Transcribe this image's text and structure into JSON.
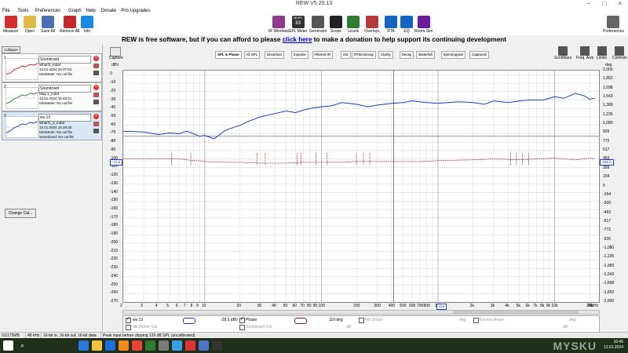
{
  "window": {
    "title": "REW V5.20.13"
  },
  "menu": [
    "File",
    "Tools",
    "Preferences",
    "Graph",
    "Help",
    "Donate",
    "Pro Upgrades"
  ],
  "toolbar_left": [
    {
      "label": "Measure",
      "color": "#d32f2f"
    },
    {
      "label": "Open",
      "color": "#e2b84a"
    },
    {
      "label": "Save All",
      "color": "#4a6fb5"
    },
    {
      "label": "Remove All",
      "color": "#c62828"
    },
    {
      "label": "Info",
      "color": "#1e88e5"
    }
  ],
  "toolbar_right": [
    {
      "label": "IR Windows",
      "color": "#8e3a8e"
    },
    {
      "label": "SPL Meter",
      "color": "#333333",
      "value": "83",
      "unit": "dB SPL"
    },
    {
      "label": "Generator",
      "color": "#555555"
    },
    {
      "label": "Scope",
      "color": "#222222"
    },
    {
      "label": "Levels",
      "color": "#2e7d32"
    },
    {
      "label": "Overlays",
      "color": "#b23b3b"
    },
    {
      "label": "RTA",
      "color": "#1565c0"
    },
    {
      "label": "EQ",
      "color": "#1565c0"
    },
    {
      "label": "Room Sim",
      "color": "#6a1b9a"
    }
  ],
  "preferences_label": "Preferences",
  "banner": {
    "text": "REW is free software, but if you can afford to please ",
    "link": "click here",
    "tail": " to make a donation to help support its continuing development"
  },
  "left": {
    "collapse": "Collapse",
    "change_cal": "Change Cal...",
    "measurements": [
      {
        "num": "1",
        "name": "Soundcard",
        "file": "Wharf1_mdat",
        "date": "13.01.2024 16:37:54",
        "cal1": "Mic/Meter: No cal file",
        "cal2": "",
        "thumb_color": "#c62828",
        "sel": false
      },
      {
        "num": "2",
        "name": "Soundcard",
        "file": "Mag 1_mdat",
        "date": "13.01.2024 16:45:21",
        "cal1": "Mic/Meter: No cal file",
        "cal2": "",
        "thumb_color": "#2e7d32",
        "sel": false
      },
      {
        "num": "3",
        "name": "ws 13",
        "file": "Wharf1_2_mdat",
        "date": "13.01.2024 16:48:26",
        "cal1": "Mic/Meter: No cal file",
        "cal2": "Soundcard: No cal file",
        "thumb_color": "#1e3bc9",
        "sel": true
      }
    ]
  },
  "graph": {
    "capture_label": "Capture",
    "tabs": [
      "SPL & Phase",
      "All SPL",
      "Distortion",
      "Impulse",
      "Filtered IR",
      "GD",
      "RT60 Decay",
      "Clarity",
      "Decay",
      "Waterfall",
      "Spectrogram",
      "Captured"
    ],
    "side_buttons": [
      "Scrollbars",
      "Freq. Axis",
      "Limits",
      "Controls"
    ],
    "y_unit_left": "dBV",
    "y_unit_right": "deg",
    "y_left": [
      "0",
      "-10",
      "-20",
      "-30",
      "-40",
      "-50",
      "-60",
      "-70",
      "-80",
      "-90",
      "-100",
      "-110",
      "-120",
      "-130",
      "-140",
      "-150",
      "-160",
      "-170",
      "-180",
      "-190",
      "-200",
      "-210",
      "-220",
      "-230",
      "-240",
      "-250",
      "-260",
      "-270"
    ],
    "y_right": [
      "2,000",
      "1,852",
      "1,698",
      "1,543",
      "1,389",
      "1,235",
      "1,080",
      "926",
      "772",
      "617",
      "463",
      "309",
      "154",
      "0",
      "-154",
      "-309",
      "-463",
      "-617",
      "-772",
      "-926",
      "-1,080",
      "-1,235",
      "-1,389",
      "-1,543",
      "-1,698",
      "-1,852",
      "-2,000"
    ],
    "cursor_left": "-72.6",
    "cursor_right": "169.0",
    "cursor_freq": "416",
    "x_ticks": [
      "2",
      "3",
      "4",
      "5",
      "6",
      "7",
      "8",
      "9",
      "10",
      "20",
      "30",
      "40",
      "50",
      "60",
      "70",
      "80",
      "90",
      "100",
      "200",
      "300",
      "400",
      "500",
      "600",
      "700",
      "800",
      "1k",
      "2k",
      "3k",
      "4k",
      "5k",
      "6k",
      "7k",
      "8k",
      "9k",
      "10k",
      "20k",
      "24kHz"
    ]
  },
  "chart_data": {
    "type": "line",
    "xscale": "log",
    "xlim": [
      2,
      24000
    ],
    "ylim_left": [
      -270,
      5
    ],
    "ylabel": "dBV",
    "series": [
      {
        "name": "ws 13",
        "color": "#1e3bc9",
        "axis": "left",
        "x": [
          2,
          3,
          4,
          5,
          6,
          7,
          8,
          9,
          10,
          12,
          15,
          20,
          25,
          30,
          40,
          50,
          60,
          70,
          80,
          100,
          120,
          150,
          200,
          250,
          300,
          400,
          500,
          600,
          800,
          1000,
          1500,
          2000,
          2500,
          3000,
          4000,
          5000,
          6000,
          8000,
          10000,
          12000,
          15000,
          18000,
          20000,
          22000
        ],
        "y": [
          -67,
          -68,
          -71,
          -69,
          -70,
          -67,
          -70,
          -73,
          -72,
          -76,
          -66,
          -60,
          -54,
          -50,
          -46,
          -43,
          -45,
          -42,
          -40,
          -38,
          -37,
          -33,
          -35,
          -38,
          -36,
          -34,
          -33,
          -31,
          -33,
          -34,
          -32,
          -33,
          -35,
          -31,
          -33,
          -31,
          -30,
          -30,
          -26,
          -28,
          -22,
          -25,
          -29,
          -28
        ]
      },
      {
        "name": "Phase",
        "color": "#8b1f1f",
        "axis": "right",
        "style": "dashed",
        "x": [
          2,
          3,
          4,
          5,
          6,
          7,
          8,
          9,
          10,
          15,
          20,
          30,
          50,
          70,
          100,
          150,
          200,
          300,
          500,
          700,
          1000,
          2000,
          3000,
          5000,
          7000,
          10000,
          15000,
          20000,
          22000
        ],
        "y": [
          -100,
          -100,
          -100,
          -100,
          -100,
          -101,
          -102,
          -102,
          -103,
          -104,
          -104,
          -105,
          -105,
          -104,
          -104,
          -104,
          -103,
          -103,
          -103,
          -103,
          -102,
          -101,
          -100,
          -101,
          -100,
          -99,
          -101,
          -99,
          -100
        ]
      }
    ]
  },
  "legend": {
    "row1": [
      {
        "checked": true,
        "label": "ws 13",
        "swatch": "#1e3bc9",
        "value": "-28.0 dBV"
      },
      {
        "checked": true,
        "label": "Phase",
        "swatch": "#8b1f1f",
        "value": "110 deg"
      },
      {
        "checked": false,
        "label": "Min phase",
        "value": "deg"
      },
      {
        "checked": false,
        "label": "Excess phase",
        "value": "deg"
      }
    ],
    "row2": [
      {
        "checked": false,
        "label": "Mic/Meter Cal",
        "value": "dB"
      },
      {
        "checked": false,
        "label": "Soundcard Cal",
        "value": "dB"
      }
    ]
  },
  "status": [
    "01/175MB",
    "48 kHz",
    "16-bit in, 16-bit out",
    "16-bit data",
    "Peak input before clipping 120 dB SPL (uncalibrated)"
  ],
  "taskbar": {
    "icons": [
      "#2b78d8",
      "#f5c542",
      "#1e6fd9",
      "#f28b1a",
      "#ea4335",
      "#2e7d32",
      "#7b7b7b",
      "#3aa0e6",
      "#d33",
      "#4e73c9",
      "#333"
    ],
    "time": "16:45",
    "date": "13.01.2024",
    "watermark": "MYSKU"
  }
}
